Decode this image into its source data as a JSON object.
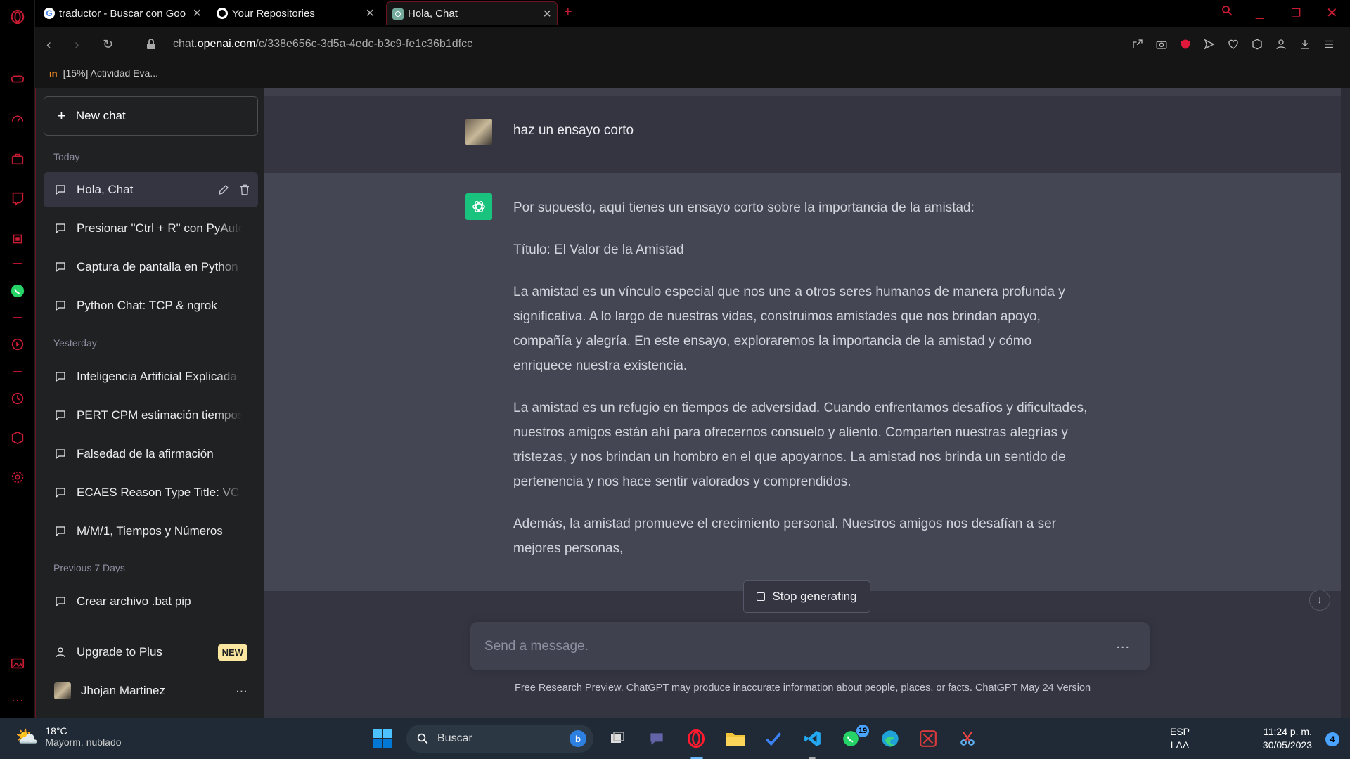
{
  "browser": {
    "tabs": [
      {
        "title": "traductor - Buscar con Goo"
      },
      {
        "title": "Your Repositories"
      },
      {
        "title": "Hola, Chat"
      }
    ],
    "url_prefix": "chat.",
    "url_domain": "openai.com",
    "url_path": "/c/338e656c-3d5a-4edc-b3c9-fe1c36b1dfcc",
    "bookmark": "[15%] Actividad Eva...",
    "accent": "#c91c33"
  },
  "sidebar": {
    "new_chat": "New chat",
    "sections": {
      "today": "Today",
      "yesterday": "Yesterday",
      "prev7": "Previous 7 Days"
    },
    "today_items": [
      "Hola, Chat",
      "Presionar \"Ctrl + R\" con PyAutoGUI",
      "Captura de pantalla en Python",
      "Python Chat: TCP & ngrok"
    ],
    "yesterday_items": [
      "Inteligencia Artificial Explicada",
      "PERT CPM estimación tiempos",
      "Falsedad de la afirmación",
      "ECAES Reason Type Title: VC",
      "M/M/1, Tiempos y Números"
    ],
    "prev7_items": [
      "Crear archivo .bat pip"
    ],
    "upgrade": "Upgrade to Plus",
    "upgrade_badge": "NEW",
    "user_name": "Jhojan Martinez",
    "more": "···"
  },
  "chat": {
    "user_message": "haz un ensayo corto",
    "answer": [
      "Por supuesto, aquí tienes un ensayo corto sobre la importancia de la amistad:",
      "Título: El Valor de la Amistad",
      "La amistad es un vínculo especial que nos une a otros seres humanos de manera profunda y significativa. A lo largo de nuestras vidas, construimos amistades que nos brindan apoyo, compañía y alegría. En este ensayo, exploraremos la importancia de la amistad y cómo enriquece nuestra existencia.",
      "La amistad es un refugio en tiempos de adversidad. Cuando enfrentamos desafíos y dificultades, nuestros amigos están ahí para ofrecernos consuelo y aliento. Comparten nuestras alegrías y tristezas, y nos brindan un hombro en el que apoyarnos. La amistad nos brinda un sentido de pertenencia y nos hace sentir valorados y comprendidos.",
      "Además, la amistad promueve el crecimiento personal. Nuestros amigos nos desafían a ser mejores personas,"
    ],
    "stop_label": "Stop generating",
    "input_placeholder": "Send a message.",
    "input_dots": "...",
    "disclaimer": "Free Research Preview. ChatGPT may produce inaccurate information about people, places, or facts.",
    "disclaimer_link": "ChatGPT May 24 Version",
    "brand_green": "#19c37d"
  },
  "taskbar": {
    "temp": "18°C",
    "weather": "Mayorm. nublado",
    "search_placeholder": "Buscar",
    "lang1": "ESP",
    "lang2": "LAA",
    "time": "11:24 p. m.",
    "date": "30/05/2023",
    "notif_count": "4",
    "whatsapp_badge": "19"
  }
}
